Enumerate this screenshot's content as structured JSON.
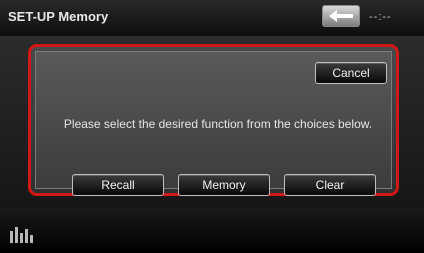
{
  "header": {
    "title": "SET-UP Memory",
    "back_icon": "back-arrow-icon",
    "clock": "--:--"
  },
  "dialog": {
    "border_color": "#d01818",
    "cancel_label": "Cancel",
    "message": "Please select the desired function from the choices below.",
    "buttons": [
      {
        "label": "Recall"
      },
      {
        "label": "Memory"
      },
      {
        "label": "Clear"
      }
    ]
  },
  "footer": {
    "icon": "equalizer-icon"
  }
}
